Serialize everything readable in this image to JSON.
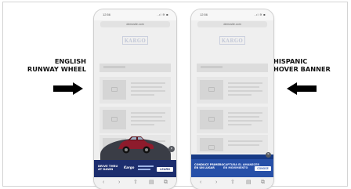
{
  "labels": {
    "left_line1": "ENGLISH",
    "left_line2": "RUNWAY WHEEL",
    "right_line1": "HISPANIC",
    "right_line2": "HOVER BANNER"
  },
  "phone": {
    "time": "12:56",
    "signal": "..ıl ≋ ■",
    "url": "demosite.com",
    "logo": "KARGO",
    "nav_icons": [
      "‹",
      "›",
      "⇧",
      "▤",
      "⧉"
    ]
  },
  "ad_english": {
    "line1": "DRIVE THRU",
    "line2": "AT DAWN",
    "cta": "LEARN MORE",
    "brand": "Kargo"
  },
  "ad_hispanic": {
    "headline_line1": "CONDUCE PRIMERO",
    "headline_line2": "EN UN LUGAR",
    "mid_line1": "CAPTURA EL AMANECER",
    "mid_line2": "EN MOVIMIENTO",
    "cta": "CONOCE MÁS"
  },
  "colors": {
    "ad_navy": "#1d2e6e",
    "ad_blue": "#2750a8",
    "car_red": "#8e1b2c",
    "arrow": "#000000"
  }
}
